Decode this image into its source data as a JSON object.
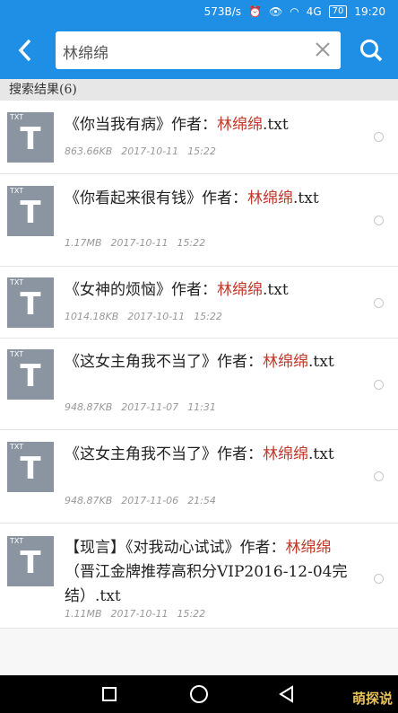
{
  "status_bar": {
    "speed": "573B/s",
    "network": "4G",
    "battery": "70",
    "time": "19:20"
  },
  "header": {
    "search_value": "林绵绵",
    "back_icon": "back-arrow-icon",
    "clear_icon": "close-icon",
    "search_icon": "search-icon"
  },
  "result_count": "搜索结果(6)",
  "items": [
    {
      "thumb_tag": "TXT",
      "thumb_glyph": "T",
      "title_pre": "《你当我有病》作者：",
      "author": "林绵绵",
      "title_post": ".txt",
      "size": "863.66KB",
      "date": "2017-10-11",
      "time": "15:22"
    },
    {
      "thumb_tag": "TXT",
      "thumb_glyph": "T",
      "title_pre": "《你看起来很有钱》作者：",
      "author": "林绵绵",
      "title_post": ".txt",
      "size": "1.17MB",
      "date": "2017-10-11",
      "time": "15:22"
    },
    {
      "thumb_tag": "TXT",
      "thumb_glyph": "T",
      "title_pre": "《女神的烦恼》作者：",
      "author": "林绵绵",
      "title_post": ".txt",
      "size": "1014.18KB",
      "date": "2017-10-11",
      "time": "15:22"
    },
    {
      "thumb_tag": "TXT",
      "thumb_glyph": "T",
      "title_pre": "《这女主角我不当了》作者：",
      "author": "林绵绵",
      "title_post": ".txt",
      "size": "948.87KB",
      "date": "2017-11-07",
      "time": "11:31"
    },
    {
      "thumb_tag": "TXT",
      "thumb_glyph": "T",
      "title_pre": "《这女主角我不当了》作者：",
      "author": "林绵绵",
      "title_post": ".txt",
      "size": "948.87KB",
      "date": "2017-11-06",
      "time": "21:54"
    },
    {
      "thumb_tag": "TXT",
      "thumb_glyph": "T",
      "title_pre": "【现言】《对我动心试试》作者：",
      "author": "林绵绵",
      "title_post": "（晋江金牌推荐高积分VIP2016-12-04完结）.txt",
      "size": "1.11MB",
      "date": "2017-10-11",
      "time": "15:22"
    }
  ],
  "watermark": "萌探说"
}
